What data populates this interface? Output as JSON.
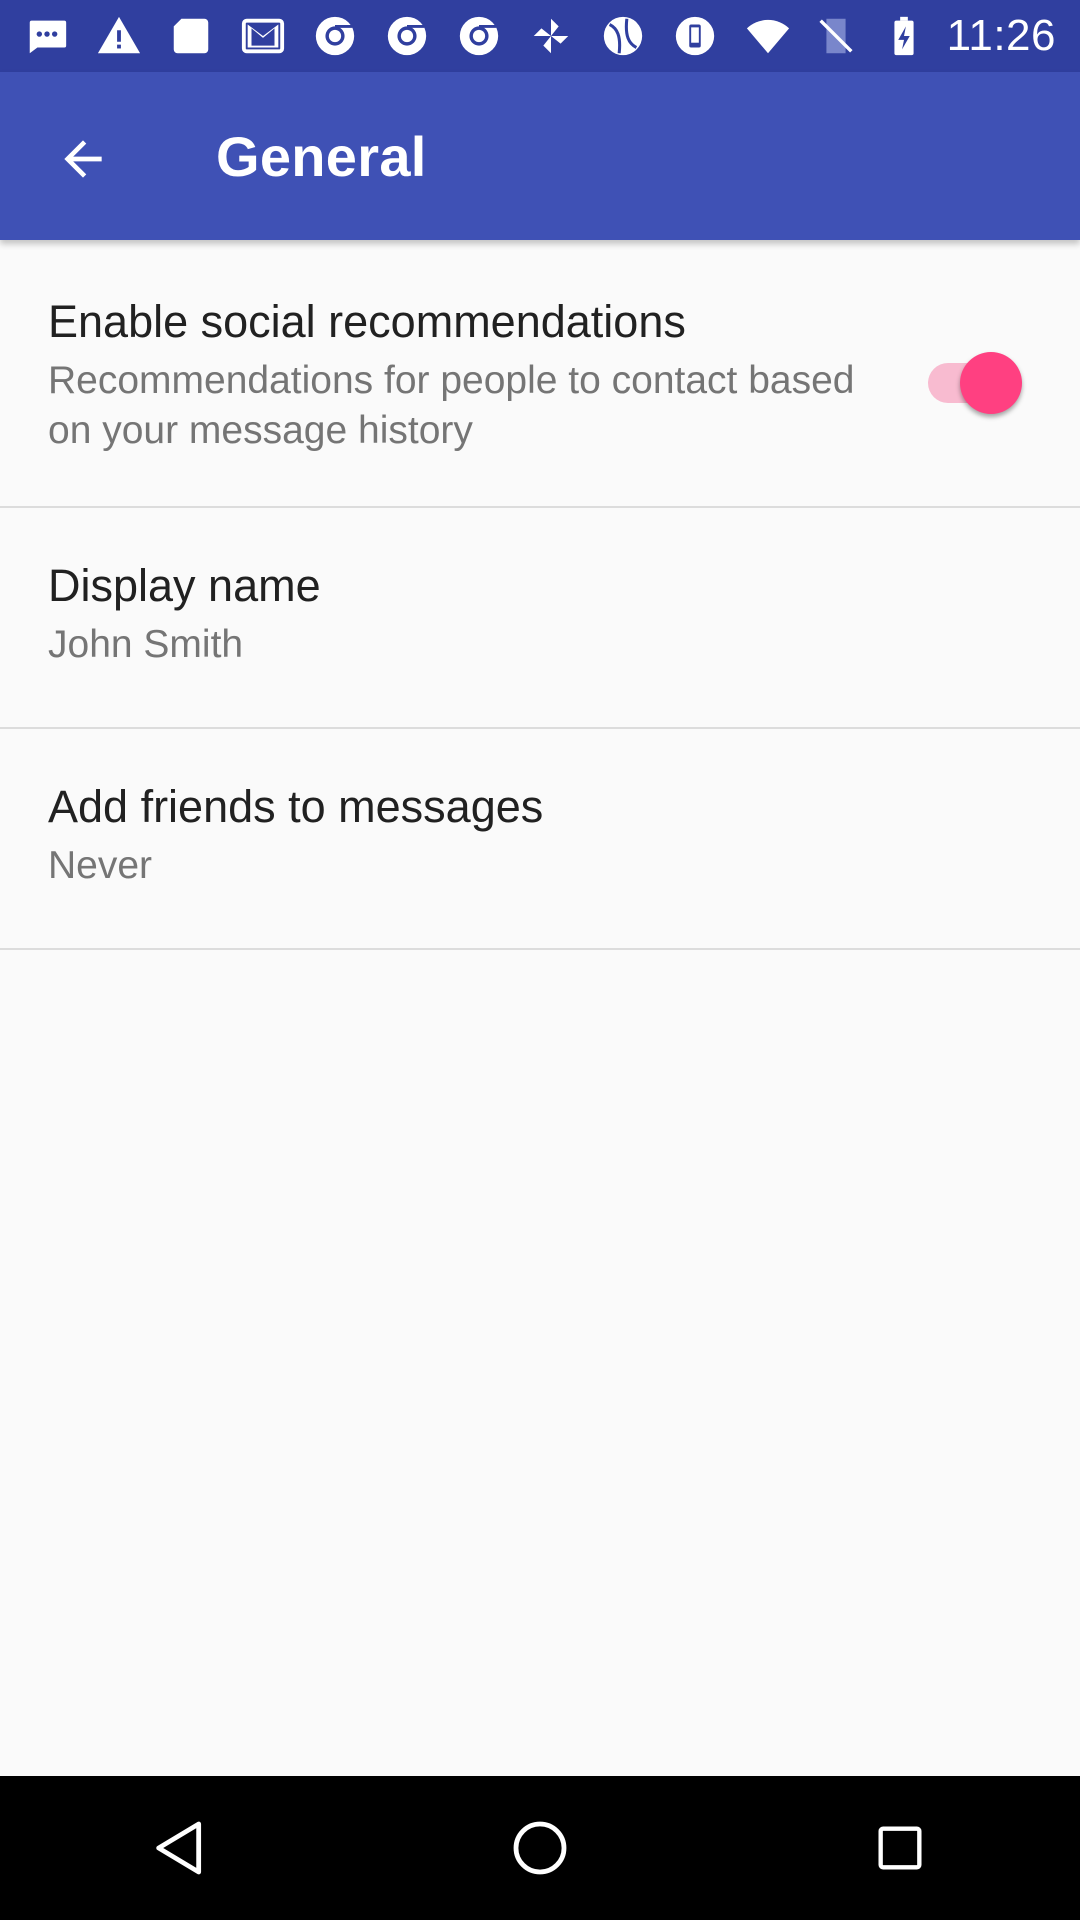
{
  "status_bar": {
    "time": "11:26",
    "left_icons": [
      "chat-icon",
      "warning-icon",
      "sd-card-icon",
      "gmail-icon",
      "chrome-icon",
      "chrome-icon",
      "chrome-icon",
      "pinwheel-icon",
      "ball-icon",
      "phone-icon"
    ],
    "right_icons": [
      "wifi-icon",
      "no-sim-icon",
      "battery-charging-icon"
    ]
  },
  "app_bar": {
    "title": "General",
    "back_icon": "arrow-back-icon"
  },
  "preferences": [
    {
      "title": "Enable social recommendations",
      "summary": "Recommendations for people to contact based on your message history",
      "switch_on": true
    },
    {
      "title": "Display name",
      "summary": "John Smith"
    },
    {
      "title": "Add friends to messages",
      "summary": "Never"
    }
  ],
  "nav_bar": {
    "buttons": [
      "back-triangle-icon",
      "home-circle-icon",
      "recents-square-icon"
    ]
  },
  "colors": {
    "status_bar": "#303f9f",
    "app_bar": "#3f51b5",
    "accent": "#ff4081",
    "background": "#fafafa"
  }
}
